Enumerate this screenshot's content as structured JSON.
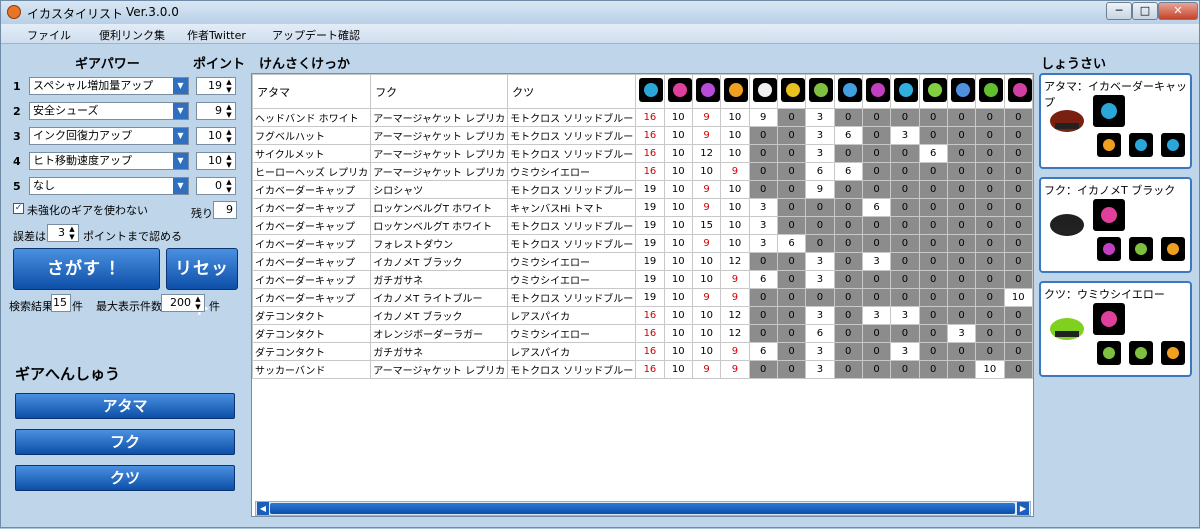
{
  "app": {
    "title": "イカスタイリスト",
    "version": "Ver.3.0.0",
    "window_buttons": [
      "─",
      "□",
      "✕"
    ]
  },
  "menu": [
    "ファイル",
    "便利リンク集",
    "作者Twitter",
    "アップデート確認"
  ],
  "left": {
    "gear_power_heading": "ギアパワー",
    "points_heading": "ポイント",
    "slots": [
      {
        "num": "1",
        "value": "スペシャル増加量アップ",
        "points": "19"
      },
      {
        "num": "2",
        "value": "安全シューズ",
        "points": "9"
      },
      {
        "num": "3",
        "value": "インク回復力アップ",
        "points": "10"
      },
      {
        "num": "4",
        "value": "ヒト移動速度アップ",
        "points": "10"
      },
      {
        "num": "5",
        "value": "なし",
        "points": "0"
      }
    ],
    "unenhanced_label": "未強化のギアを使わない",
    "unenhanced_checked": true,
    "remaining_label": "残り",
    "remaining_value": "9",
    "tolerance_prefix": "誤差は",
    "tolerance_value": "3",
    "tolerance_suffix": "ポイントまで認める",
    "search_button": "さがす ！",
    "reset_button": "リセット",
    "result_count_label": "検索結果",
    "result_count": "15",
    "result_count_unit": "件",
    "max_display_label": "最大表示件数",
    "max_display": "200",
    "max_display_unit": "件",
    "gear_edit_heading": "ギアへんしゅう",
    "gear_buttons": [
      "アタマ",
      "フク",
      "クツ"
    ]
  },
  "results": {
    "heading": "けんさくけっか",
    "columns": [
      "アタマ",
      "フク",
      "クツ"
    ],
    "ability_icons": [
      {
        "name": "special-charge-up-icon",
        "color": "#2aa6d8"
      },
      {
        "name": "ink-resistance-icon",
        "color": "#e0409c"
      },
      {
        "name": "run-speed-up-icon",
        "color": "#b84bd8"
      },
      {
        "name": "swim-speed-up-icon",
        "color": "#f0a020"
      },
      {
        "name": "quick-respawn-icon",
        "color": "#f0f0f0"
      },
      {
        "name": "defense-up-icon",
        "color": "#e8c020"
      },
      {
        "name": "damage-up-icon",
        "color": "#80c040"
      },
      {
        "name": "ink-saver-sub-icon",
        "color": "#40a0e0"
      },
      {
        "name": "special-saver-icon",
        "color": "#c040c0"
      },
      {
        "name": "quick-super-jump-icon",
        "color": "#30b0e0"
      },
      {
        "name": "special-duration-up-icon",
        "color": "#80d040"
      },
      {
        "name": "bomb-range-up-icon",
        "color": "#5090e0"
      },
      {
        "name": "ink-recovery-up-icon",
        "color": "#60c030"
      },
      {
        "name": "tenacity-icon",
        "color": "#d040a0"
      }
    ],
    "rows": [
      {
        "head": "ヘッドバンド ホワイト",
        "cloth": "アーマージャケット レプリカ",
        "shoes": "モトクロス ソリッドブルー",
        "v": [
          "16",
          "10",
          "9",
          "10",
          "9",
          "0",
          "3",
          "0",
          "0",
          "0",
          "0",
          "0",
          "0",
          "0"
        ],
        "red": [
          0,
          2
        ]
      },
      {
        "head": "フグベルハット",
        "cloth": "アーマージャケット レプリカ",
        "shoes": "モトクロス ソリッドブルー",
        "v": [
          "16",
          "10",
          "9",
          "10",
          "0",
          "0",
          "3",
          "6",
          "0",
          "3",
          "0",
          "0",
          "0",
          "0"
        ],
        "red": [
          0,
          2
        ]
      },
      {
        "head": "サイクルメット",
        "cloth": "アーマージャケット レプリカ",
        "shoes": "モトクロス ソリッドブルー",
        "v": [
          "16",
          "10",
          "12",
          "10",
          "0",
          "0",
          "3",
          "0",
          "0",
          "0",
          "6",
          "0",
          "0",
          "0"
        ],
        "red": [
          0
        ]
      },
      {
        "head": "ヒーローヘッズ レプリカ",
        "cloth": "アーマージャケット レプリカ",
        "shoes": "ウミウシイエロー",
        "v": [
          "16",
          "10",
          "10",
          "9",
          "0",
          "0",
          "6",
          "6",
          "0",
          "0",
          "0",
          "0",
          "0",
          "0"
        ],
        "red": [
          0,
          3
        ]
      },
      {
        "head": "イカベーダーキャップ",
        "cloth": "シロシャツ",
        "shoes": "モトクロス ソリッドブルー",
        "v": [
          "19",
          "10",
          "9",
          "10",
          "0",
          "0",
          "9",
          "0",
          "0",
          "0",
          "0",
          "0",
          "0",
          "0"
        ],
        "red": [
          2
        ]
      },
      {
        "head": "イカベーダーキャップ",
        "cloth": "ロッケンベルグT ホワイト",
        "shoes": "キャンバスHi トマト",
        "v": [
          "19",
          "10",
          "9",
          "10",
          "3",
          "0",
          "0",
          "0",
          "6",
          "0",
          "0",
          "0",
          "0",
          "0"
        ],
        "red": [
          2
        ]
      },
      {
        "head": "イカベーダーキャップ",
        "cloth": "ロッケンベルグT ホワイト",
        "shoes": "モトクロス ソリッドブルー",
        "v": [
          "19",
          "10",
          "15",
          "10",
          "3",
          "0",
          "0",
          "0",
          "0",
          "0",
          "0",
          "0",
          "0",
          "0"
        ],
        "red": []
      },
      {
        "head": "イカベーダーキャップ",
        "cloth": "フォレストダウン",
        "shoes": "モトクロス ソリッドブルー",
        "v": [
          "19",
          "10",
          "9",
          "10",
          "3",
          "6",
          "0",
          "0",
          "0",
          "0",
          "0",
          "0",
          "0",
          "0"
        ],
        "red": [
          2
        ]
      },
      {
        "head": "イカベーダーキャップ",
        "cloth": "イカノメT ブラック",
        "shoes": "ウミウシイエロー",
        "v": [
          "19",
          "10",
          "10",
          "12",
          "0",
          "0",
          "3",
          "0",
          "3",
          "0",
          "0",
          "0",
          "0",
          "0"
        ],
        "red": []
      },
      {
        "head": "イカベーダーキャップ",
        "cloth": "ガチガサネ",
        "shoes": "ウミウシイエロー",
        "v": [
          "19",
          "10",
          "10",
          "9",
          "6",
          "0",
          "3",
          "0",
          "0",
          "0",
          "0",
          "0",
          "0",
          "0"
        ],
        "red": [
          3
        ]
      },
      {
        "head": "イカベーダーキャップ",
        "cloth": "イカノメT ライトブルー",
        "shoes": "モトクロス ソリッドブルー",
        "v": [
          "19",
          "10",
          "9",
          "9",
          "0",
          "0",
          "0",
          "0",
          "0",
          "0",
          "0",
          "0",
          "0",
          "10"
        ],
        "red": [
          2,
          3
        ]
      },
      {
        "head": "ダテコンタクト",
        "cloth": "イカノメT ブラック",
        "shoes": "レアスパイカ",
        "v": [
          "16",
          "10",
          "10",
          "12",
          "0",
          "0",
          "3",
          "0",
          "3",
          "3",
          "0",
          "0",
          "0",
          "0"
        ],
        "red": [
          0
        ]
      },
      {
        "head": "ダテコンタクト",
        "cloth": "オレンジボーダーラガー",
        "shoes": "ウミウシイエロー",
        "v": [
          "16",
          "10",
          "10",
          "12",
          "0",
          "0",
          "6",
          "0",
          "0",
          "0",
          "0",
          "3",
          "0",
          "0"
        ],
        "red": [
          0
        ]
      },
      {
        "head": "ダテコンタクト",
        "cloth": "ガチガサネ",
        "shoes": "レアスパイカ",
        "v": [
          "16",
          "10",
          "10",
          "9",
          "6",
          "0",
          "3",
          "0",
          "0",
          "3",
          "0",
          "0",
          "0",
          "0"
        ],
        "red": [
          0,
          3
        ]
      },
      {
        "head": "サッカーバンド",
        "cloth": "アーマージャケット レプリカ",
        "shoes": "モトクロス ソリッドブルー",
        "v": [
          "16",
          "10",
          "9",
          "9",
          "0",
          "0",
          "3",
          "0",
          "0",
          "0",
          "0",
          "0",
          "10",
          "0"
        ],
        "red": [
          0,
          2,
          3
        ]
      }
    ]
  },
  "detail": {
    "heading": "しょうさい",
    "cards": [
      {
        "title": "アタマ：イカベーダーキャップ",
        "gear_color": "#7a2010",
        "main_color": "#2aa6d8",
        "subs": [
          "#f0a020",
          "#2aa6d8",
          "#2aa6d8"
        ]
      },
      {
        "title": "フク：イカノメT ブラック",
        "gear_color": "#202020",
        "main_color": "#e0409c",
        "subs": [
          "#c040c0",
          "#80c040",
          "#f0a020"
        ]
      },
      {
        "title": "クツ：ウミウシイエロー",
        "gear_color": "#80d020",
        "main_color": "#e0409c",
        "subs": [
          "#80c040",
          "#80c040",
          "#f0a020"
        ]
      }
    ]
  }
}
